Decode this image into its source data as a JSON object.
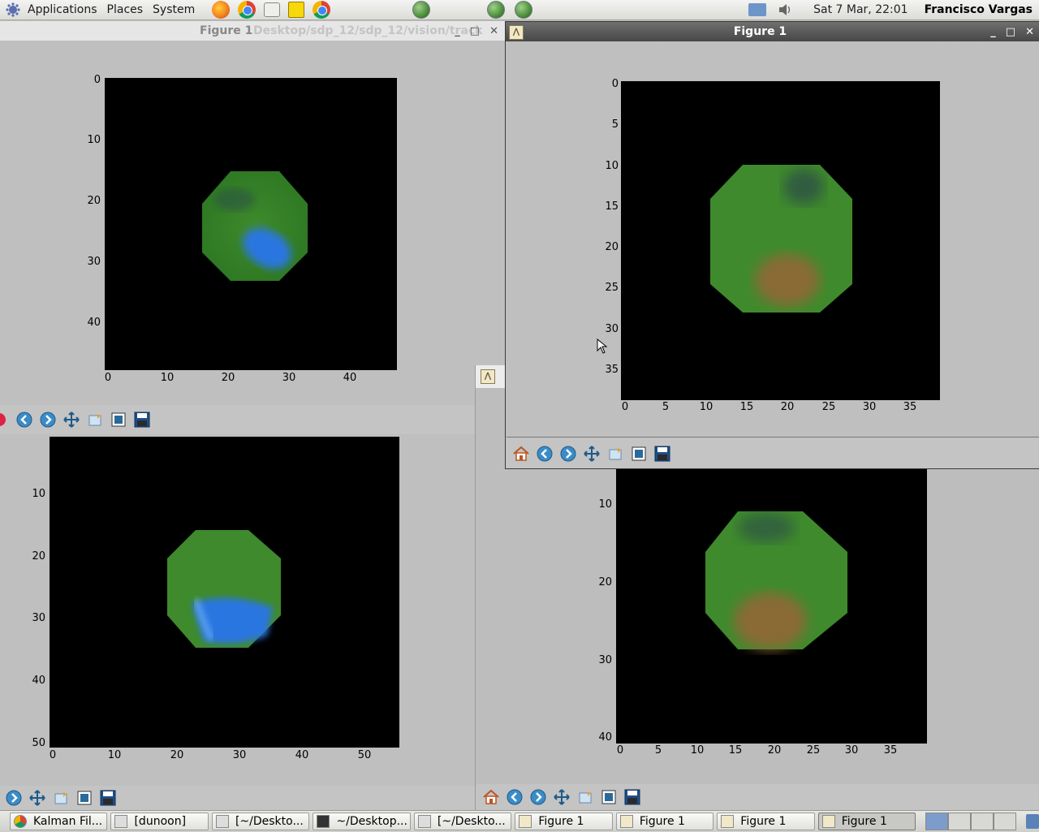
{
  "top_panel": {
    "menus": [
      "Applications",
      "Places",
      "System"
    ],
    "launchers": [
      "firefox-icon",
      "chrome-icon",
      "mail-icon",
      "notes-icon",
      "chrome-icon"
    ],
    "clock": "Sat  7 Mar, 22:01",
    "user": "Francisco Vargas"
  },
  "windows": {
    "top_left": {
      "title": "Figure 1",
      "title_ghost": "Desktop/sdp_12/sdp_12/vision/track",
      "yticks": [
        "0",
        "10",
        "20",
        "30",
        "40"
      ],
      "xticks": [
        "0",
        "10",
        "20",
        "30",
        "40"
      ]
    },
    "bottom_left": {
      "yticks": [
        "10",
        "20",
        "30",
        "40",
        "50"
      ],
      "xticks": [
        "0",
        "10",
        "20",
        "30",
        "40",
        "50"
      ]
    },
    "bottom_right": {
      "yticks": [
        "10",
        "20",
        "30",
        "40"
      ],
      "xticks": [
        "0",
        "5",
        "10",
        "15",
        "20",
        "25",
        "30",
        "35"
      ]
    },
    "front": {
      "title": "Figure 1",
      "yticks": [
        "0",
        "5",
        "10",
        "15",
        "20",
        "25",
        "30",
        "35"
      ],
      "xticks": [
        "0",
        "5",
        "10",
        "15",
        "20",
        "25",
        "30",
        "35"
      ]
    }
  },
  "toolbar_icons": [
    "home-icon",
    "back-icon",
    "forward-icon",
    "pan-icon",
    "zoom-icon",
    "configure-subplots-icon",
    "save-icon"
  ],
  "taskbar": {
    "tasks": [
      "Kalman Fil...",
      "[dunoon]",
      "[~/Deskto...",
      "~/Desktop...",
      "[~/Deskto...",
      "Figure 1",
      "Figure 1",
      "Figure 1",
      "Figure 1"
    ]
  },
  "colors": {
    "panel_bg": "#dcdcd8",
    "active_title": "#474747",
    "plot_bg": "#000000",
    "blob_green": "#3f8a2c",
    "blob_blue": "#2a76e0",
    "blob_brown": "#8a6a34"
  }
}
